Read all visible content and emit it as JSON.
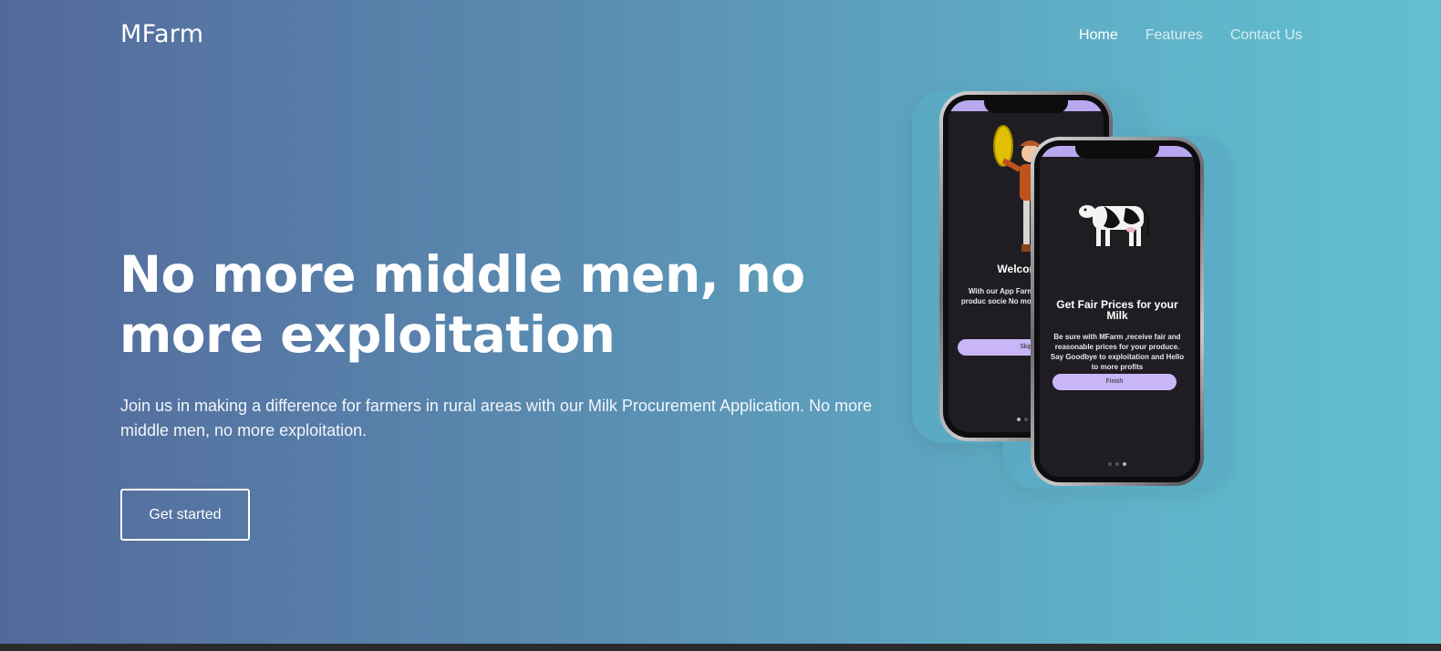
{
  "nav": {
    "brand": "MFarm",
    "links": [
      {
        "label": "Home",
        "active": true
      },
      {
        "label": "Features",
        "active": false
      },
      {
        "label": "Contact Us",
        "active": false
      }
    ]
  },
  "hero": {
    "title": "No more middle men, no more exploitation",
    "description": "Join us in making a difference for farmers in rural areas with our Milk Procurement Application. No more middle men, no more exploitation.",
    "cta_label": "Get started"
  },
  "phone_back": {
    "title": "Welcome T",
    "body": "With our App Farme delivery Milk produc socie No more middlem profit",
    "button": "Skip"
  },
  "phone_front": {
    "title": "Get Fair Prices for your Milk",
    "body": "Be sure with MFarm ,receive fair and reasonable prices for your produce. Say Goodbye to exploitation and Hello to more profits",
    "button": "Finish"
  },
  "colors": {
    "gradient_start": "#53699b",
    "gradient_end": "#62c0d0",
    "button_accent": "#c9b6f7"
  }
}
